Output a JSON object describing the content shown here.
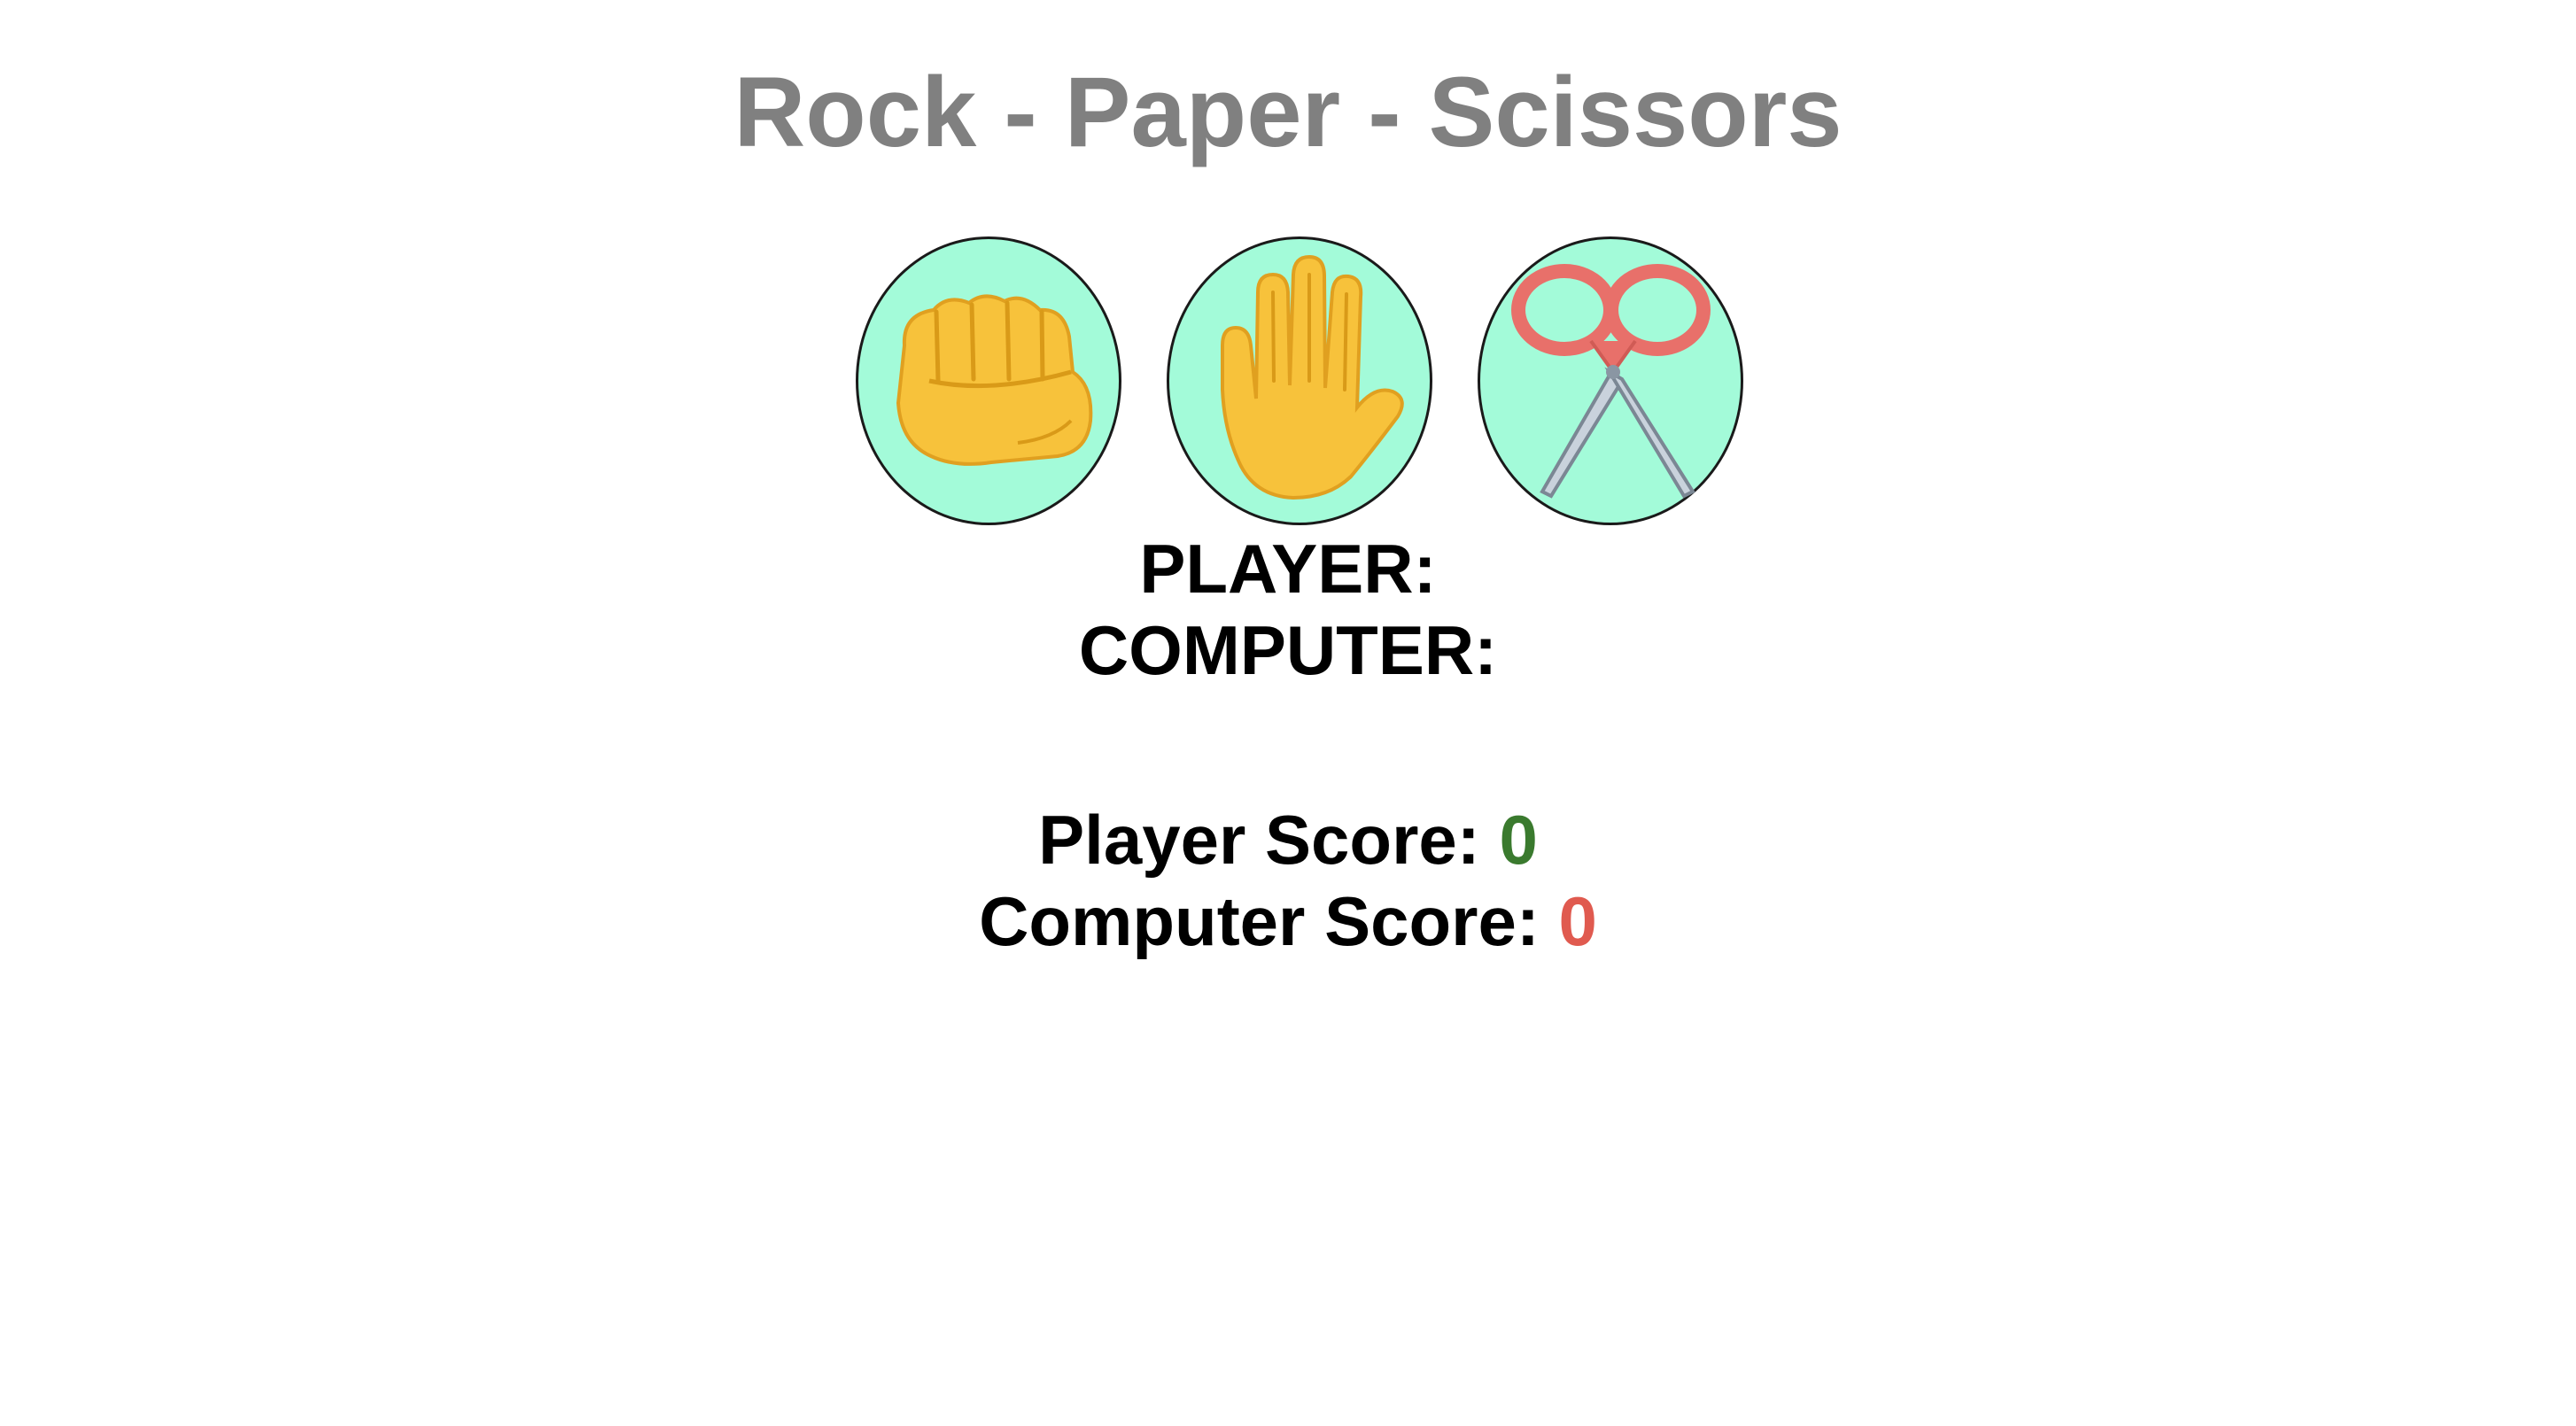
{
  "title": "Rock - Paper - Scissors",
  "choices": [
    {
      "id": "rock",
      "icon": "rock-fist-icon"
    },
    {
      "id": "paper",
      "icon": "raised-hand-icon"
    },
    {
      "id": "scissors",
      "icon": "scissors-icon"
    }
  ],
  "selection": {
    "player_label": "PLAYER:",
    "player_value": "",
    "computer_label": "COMPUTER:",
    "computer_value": ""
  },
  "score": {
    "player_label": "Player Score: ",
    "player_value": "0",
    "computer_label": "Computer Score: ",
    "computer_value": "0"
  },
  "colors": {
    "title": "#808080",
    "button_bg": "#a3fbd9",
    "player_score": "#3a7a2e",
    "computer_score": "#e05a4f"
  }
}
